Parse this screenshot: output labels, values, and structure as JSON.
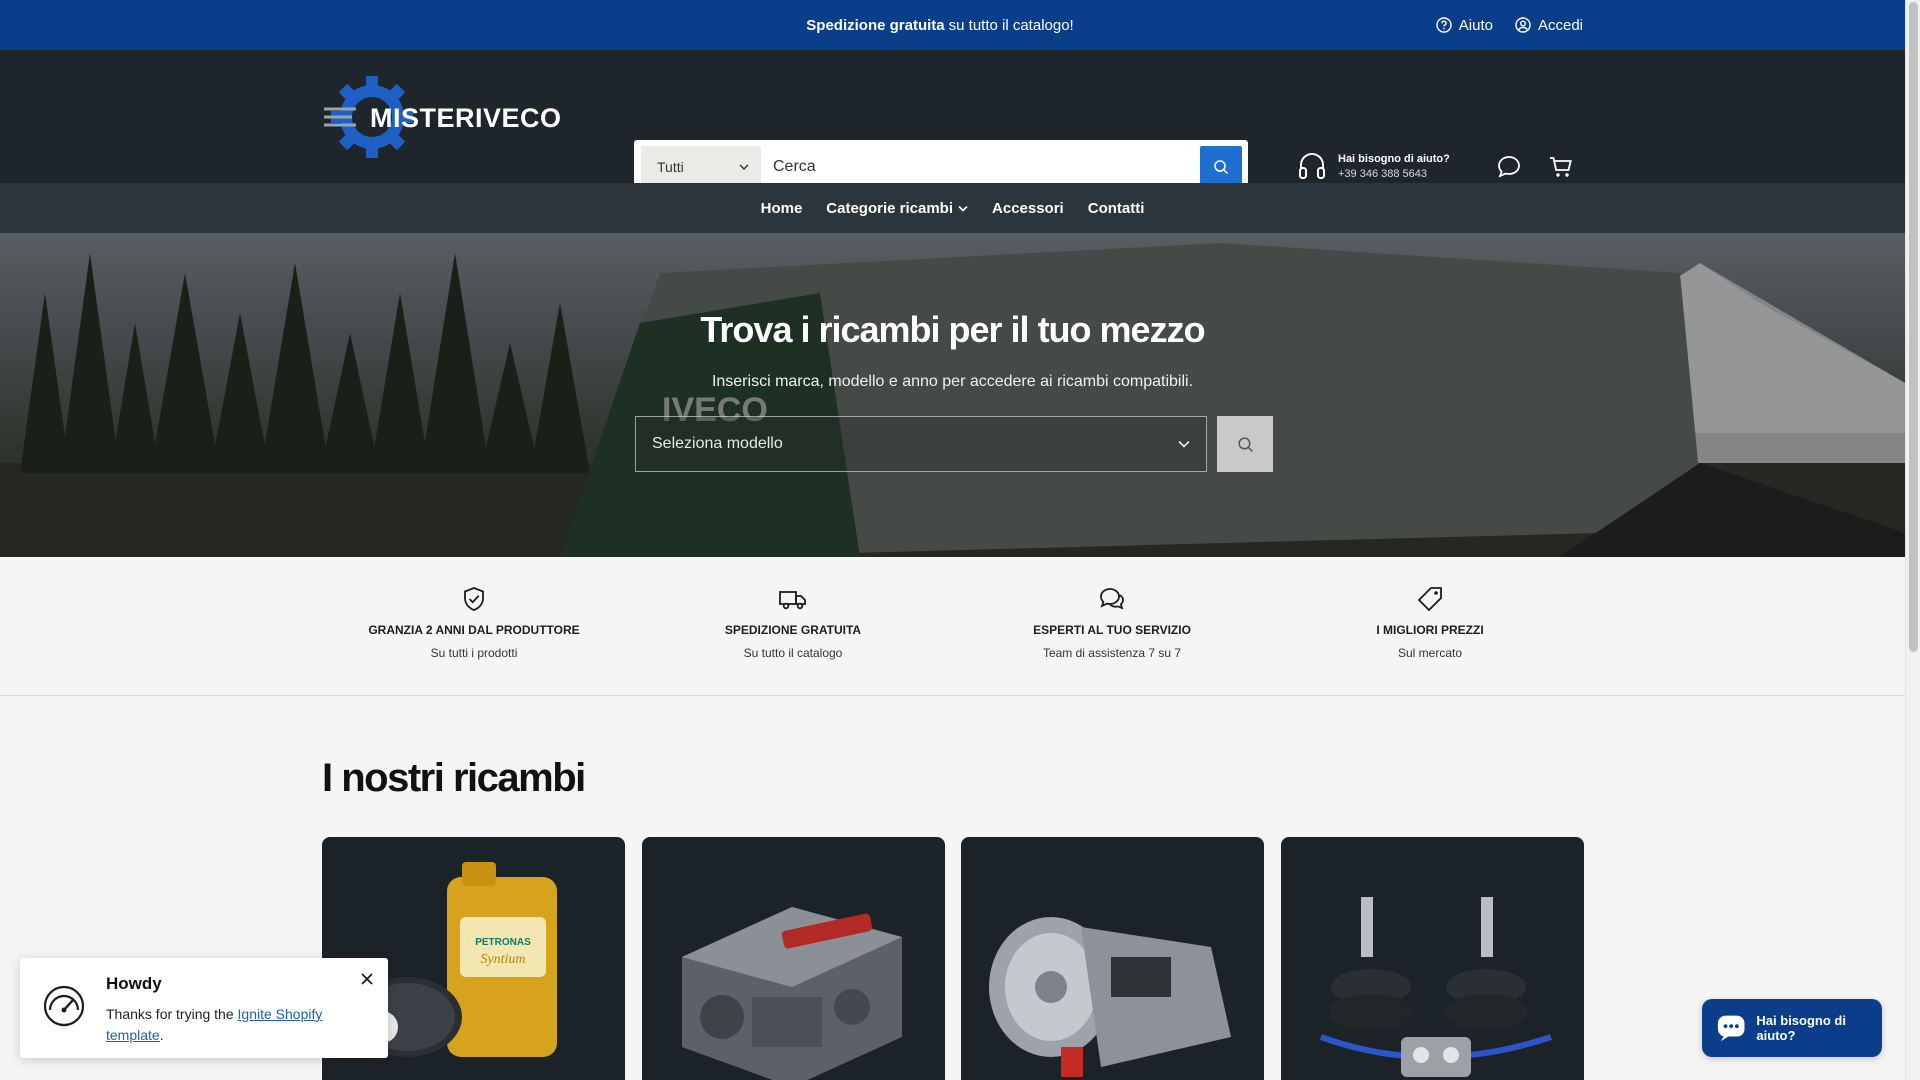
{
  "announcement": {
    "bold": "Spedizione gratuita",
    "text": "su tutto il catalogo!",
    "help_label": "Aiuto",
    "login_label": "Accedi"
  },
  "header": {
    "logo_text": "MISTERIVECO",
    "search": {
      "category": "Tutti",
      "placeholder": "Cerca"
    },
    "help": {
      "title": "Hai bisogno di aiuto?",
      "phone": "+39 346 388 5643"
    }
  },
  "nav": {
    "items": [
      {
        "label": "Home"
      },
      {
        "label": "Categorie ricambi"
      },
      {
        "label": "Accessori"
      },
      {
        "label": "Contatti"
      }
    ]
  },
  "hero": {
    "title": "Trova i ricambi per il tuo mezzo",
    "subtitle": "Inserisci marca, modello e anno per accedere ai ricambi compatibili.",
    "select_placeholder": "Seleziona modello",
    "truck_brand": "IVECO"
  },
  "features": [
    {
      "title": "GRANZIA 2 ANNI DAL PRODUTTORE",
      "subtitle": "Su tutti i prodotti",
      "icon": "shield-check-icon"
    },
    {
      "title": "SPEDIZIONE GRATUITA",
      "subtitle": "Su tutto il catalogo",
      "icon": "truck-icon"
    },
    {
      "title": "ESPERTI AL TUO SERVIZIO",
      "subtitle": "Team di assistenza 7 su 7",
      "icon": "chat-icon"
    },
    {
      "title": "I MIGLIORI PREZZI",
      "subtitle": "Sul mercato",
      "icon": "price-tag-icon"
    }
  ],
  "products": {
    "title": "I nostri ricambi",
    "cards": [
      {
        "name": "oil-product-image",
        "label": "PETRONAS SYNTIUM"
      },
      {
        "name": "engine-product-image"
      },
      {
        "name": "transmission-product-image"
      },
      {
        "name": "air-suspension-product-image"
      }
    ]
  },
  "howdy": {
    "title": "Howdy",
    "text_before": "Thanks for trying the",
    "link": "Ignite Shopify template",
    "text_after": "."
  },
  "chat": {
    "label": "Hai bisogno di aiuto?"
  },
  "colors": {
    "announcement_bg": "#0b3e8a",
    "header_bg": "#1e262c",
    "nav_bg": "#2c353c",
    "accent": "#1f6fd1"
  }
}
